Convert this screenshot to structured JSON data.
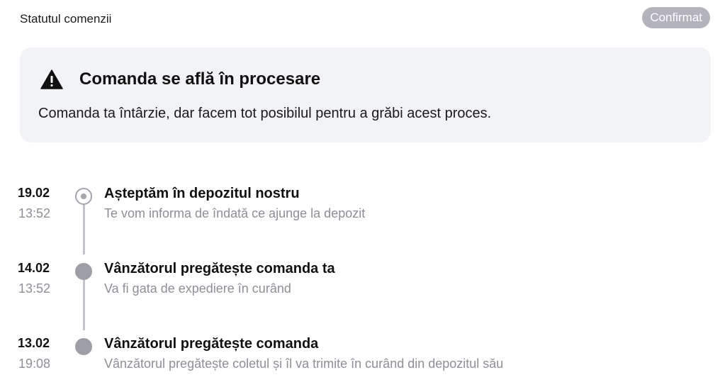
{
  "header": {
    "title": "Statutul comenzii",
    "status_badge": "Confirmat"
  },
  "notice": {
    "icon": "warning-triangle-icon",
    "title": "Comanda se află în procesare",
    "body": "Comanda ta întârzie, dar facem tot posibilul pentru a grăbi acest proces."
  },
  "timeline": {
    "items": [
      {
        "date": "19.02",
        "time": "13:52",
        "title": "Așteptăm în depozitul nostru",
        "description": "Te vom informa de îndată ce ajunge la depozit",
        "state": "current"
      },
      {
        "date": "14.02",
        "time": "13:52",
        "title": "Vânzătorul pregătește comanda ta",
        "description": "Va fi gata de expediere în curând",
        "state": "completed"
      },
      {
        "date": "13.02",
        "time": "19:08",
        "title": "Vânzătorul pregătește comanda",
        "description": "Vânzătorul pregătește coletul și îl va trimite în curând din depozitul său",
        "state": "completed"
      }
    ]
  },
  "colors": {
    "badge_bg": "#b3b3bb",
    "notice_bg": "#f2f3f6",
    "timeline_dot": "#9e9ea6",
    "muted_text": "#8e8e96"
  }
}
